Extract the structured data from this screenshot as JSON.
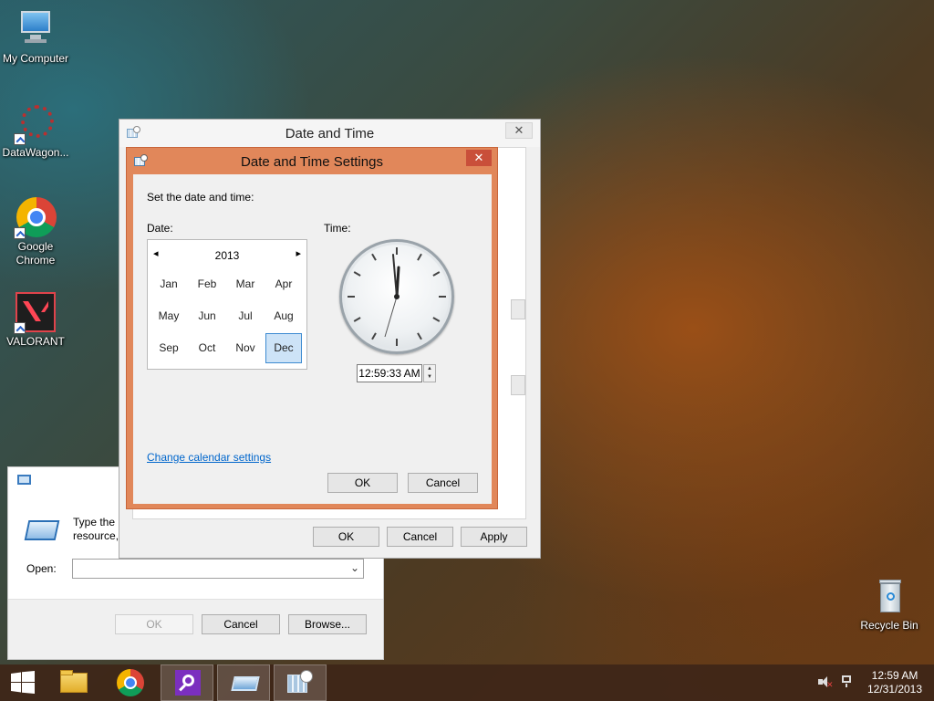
{
  "desktop": {
    "icons": [
      {
        "label": "My Computer",
        "icon": "computer-icon"
      },
      {
        "label": "DataWagon...",
        "icon": "datawagon-icon"
      },
      {
        "label": "Google Chrome",
        "icon": "chrome-icon"
      },
      {
        "label": "VALORANT",
        "icon": "valorant-icon"
      },
      {
        "label": "Recycle Bin",
        "icon": "recycle-bin-icon"
      }
    ]
  },
  "run_dialog": {
    "description_line1": "Type the r",
    "description_line2": "resource,",
    "open_label": "Open:",
    "open_value": "",
    "ok_label": "OK",
    "cancel_label": "Cancel",
    "browse_label": "Browse..."
  },
  "date_time_dialog": {
    "title": "Date and Time",
    "close_label": "✕",
    "ok_label": "OK",
    "cancel_label": "Cancel",
    "apply_label": "Apply"
  },
  "date_time_settings": {
    "title": "Date and Time Settings",
    "close_label": "✕",
    "instruction": "Set the date and time:",
    "date_label": "Date:",
    "time_label": "Time:",
    "year": "2013",
    "prev_arrow": "◂",
    "next_arrow": "▸",
    "months": [
      "Jan",
      "Feb",
      "Mar",
      "Apr",
      "May",
      "Jun",
      "Jul",
      "Aug",
      "Sep",
      "Oct",
      "Nov",
      "Dec"
    ],
    "selected_month": "Dec",
    "time_value": "12:59:33 AM",
    "change_calendar_link": "Change calendar settings",
    "ok_label": "OK",
    "cancel_label": "Cancel"
  },
  "taskbar": {
    "items": [
      "start-button",
      "file-explorer-icon",
      "chrome-icon",
      "search-app-icon",
      "run-icon",
      "date-time-icon"
    ],
    "clock_time": "12:59 AM",
    "clock_date": "12/31/2013"
  }
}
